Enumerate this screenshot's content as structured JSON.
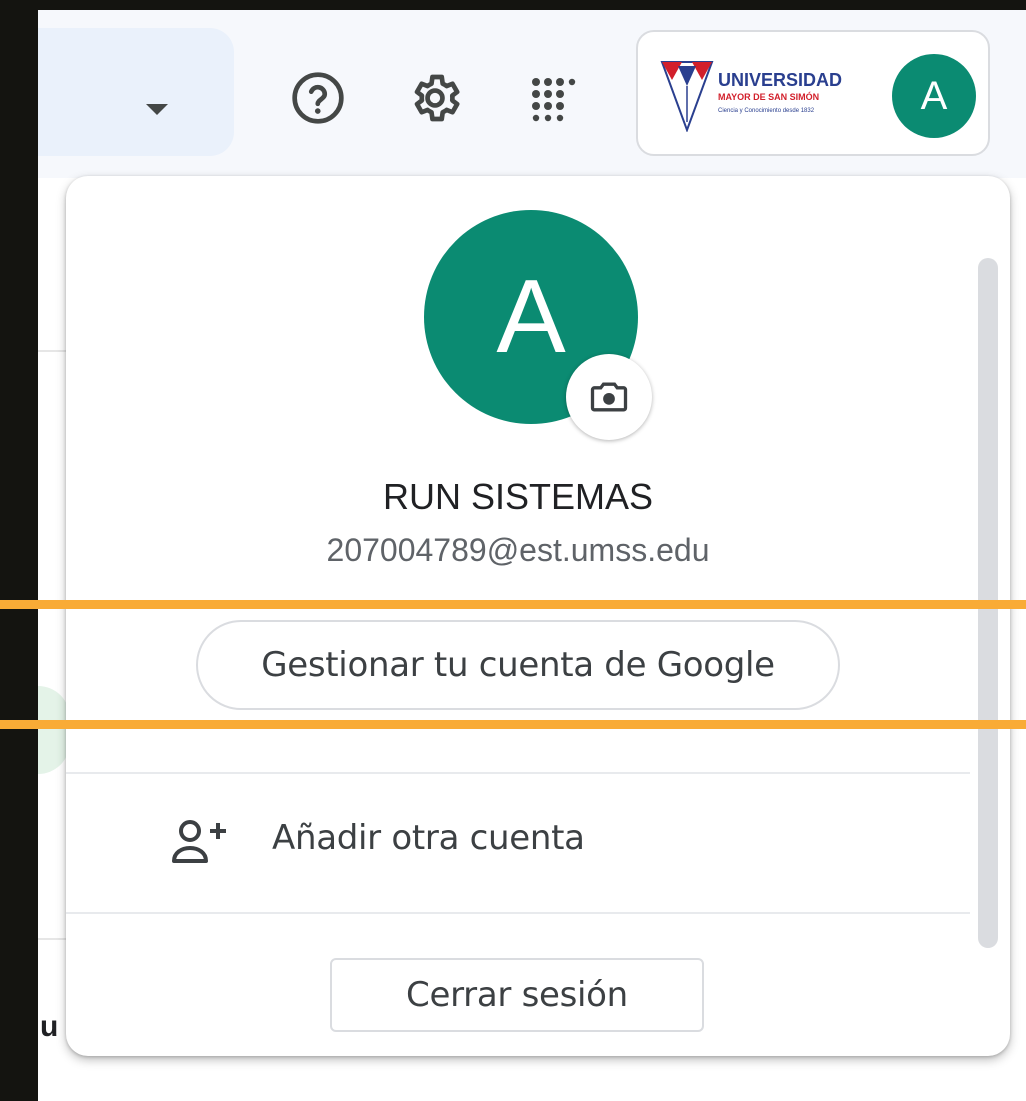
{
  "header": {
    "help_icon": "help-circle-icon",
    "settings_icon": "gear-icon",
    "apps_icon": "apps-grid-icon",
    "org_logo": {
      "line1": "UNIVERSIDAD",
      "line2": "MAYOR DE SAN SIMÓN",
      "line3": "Ciencia y Conocimiento desde 1832"
    },
    "avatar_letter": "A"
  },
  "popup": {
    "avatar_letter": "A",
    "camera_icon": "camera-icon",
    "name": "RUN SISTEMAS",
    "email": "207004789@est.umss.edu",
    "manage_label": "Gestionar tu cuenta de Google",
    "add_account_icon": "person-add-icon",
    "add_account_label": "Añadir otra cuenta",
    "signout_label": "Cerrar sesión"
  },
  "background": {
    "partial_letter": "u"
  },
  "colors": {
    "avatar": "#0b8b72",
    "highlight": "#f9ab36",
    "frame": "#141410"
  }
}
